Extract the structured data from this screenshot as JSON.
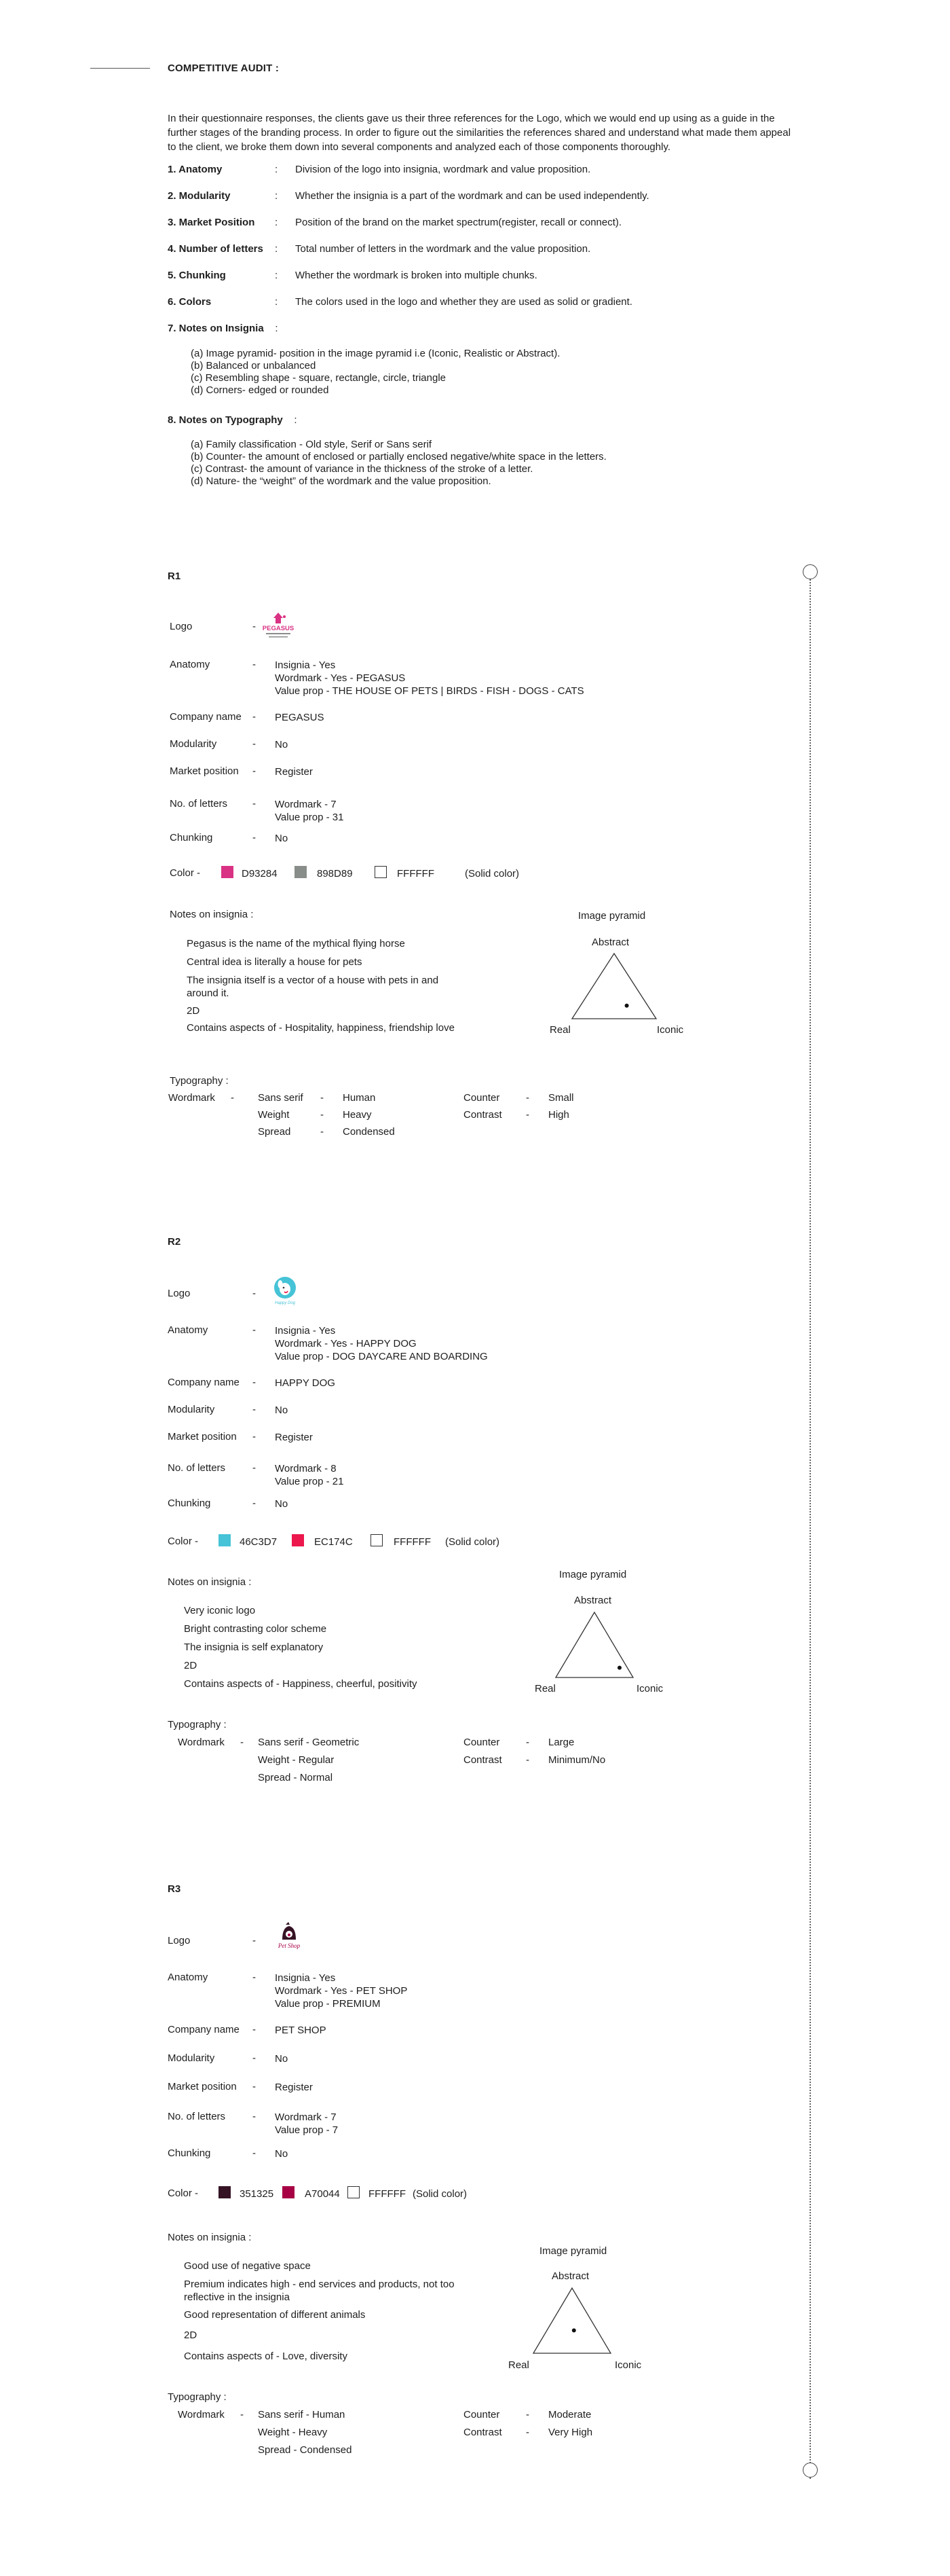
{
  "header": {
    "title": "COMPETITIVE AUDIT :"
  },
  "intro": "In their questionnaire responses, the clients gave us their three references for the Logo, which we would end up using as a guide in the further stages of the branding process. In order to figure out the similarities the references shared and understand what made them appeal to the client, we broke them down into several components and analyzed each of those components thoroughly.",
  "criteria": [
    {
      "key": "1. Anatomy",
      "desc": "Division of the logo into insignia, wordmark and value proposition."
    },
    {
      "key": "2. Modularity",
      "desc": "Whether the insignia is a part of the wordmark and can be used independently."
    },
    {
      "key": "3. Market Position",
      "desc": "Position of the brand on the market spectrum(register, recall or connect)."
    },
    {
      "key": "4. Number of letters",
      "desc": "Total number of letters in the wordmark and the value proposition."
    },
    {
      "key": "5. Chunking",
      "desc": "Whether the wordmark is broken into multiple chunks."
    },
    {
      "key": "6. Colors",
      "desc": "The colors used in the logo and whether they are used as solid or gradient."
    },
    {
      "key": "7. Notes on Insignia",
      "desc": ""
    },
    {
      "key": "8. Notes on Typography",
      "desc": ""
    }
  ],
  "insignia_notes": [
    "(a) Image pyramid- position in the image pyramid i.e (Iconic, Realistic or Abstract).",
    "(b) Balanced or unbalanced",
    "(c) Resembling shape - square, rectangle, circle, triangle",
    "(d) Corners- edged or rounded"
  ],
  "typography_notes": [
    "(a) Family classification - Old style, Serif or Sans serif",
    "(b) Counter- the amount of enclosed or partially enclosed negative/white space in the letters.",
    "(c) Contrast- the amount of variance in the thickness of the stroke of a letter.",
    "(d) Nature- the “weight” of the wordmark and the value proposition."
  ],
  "labels": {
    "logo": "Logo",
    "anatomy": "Anatomy",
    "company": "Company name",
    "modularity": "Modularity",
    "market": "Market position",
    "letters": "No. of letters",
    "chunking": "Chunking",
    "color": "Color",
    "notes": "Notes on insignia :",
    "typography": "Typography :",
    "wordmark": "Wordmark",
    "counter": "Counter",
    "contrast": "Contrast",
    "dash": "-",
    "pyramid_title": "Image pyramid",
    "abstract": "Abstract",
    "real": "Real",
    "iconic": "Iconic"
  },
  "references": [
    {
      "id": "R1",
      "logo_icon": "pegasus-logo",
      "logo_text": "PEGASUS",
      "anatomy": [
        "Insignia - Yes",
        "Wordmark - Yes - PEGASUS",
        "Value prop - THE HOUSE OF PETS | BIRDS - FISH - DOGS - CATS"
      ],
      "company": "PEGASUS",
      "modularity": "No",
      "market": "Register",
      "letters": [
        "Wordmark -  7",
        "Value prop -  31"
      ],
      "chunking": "No",
      "colors": [
        {
          "hex": "#D93284",
          "label": "D93284"
        },
        {
          "hex": "#898D89",
          "label": "898D89"
        },
        {
          "hex": "#FFFFFF",
          "label": "FFFFFF"
        }
      ],
      "color_type": "(Solid color)",
      "notes": [
        "Pegasus is the name of the mythical flying horse",
        "Central idea is literally a house for pets",
        "The insignia itself is a vector of a house with pets in and around it.",
        "2D",
        "Contains aspects of - Hospitality, happiness, friendship love"
      ],
      "pyramid_point": {
        "real": 0.25,
        "iconic": 0.55,
        "abstract": 0.2
      },
      "typography": {
        "family_label": "Sans serif",
        "family": "Human",
        "weight_label": "Weight",
        "weight": "Heavy",
        "spread_label": "Spread",
        "spread": "Condensed",
        "counter": "Small",
        "contrast": "High"
      }
    },
    {
      "id": "R2",
      "logo_icon": "happy-dog-logo",
      "logo_text": "Happy Dog",
      "anatomy": [
        "Insignia - Yes",
        "Wordmark - Yes - HAPPY DOG",
        "Value prop - DOG DAYCARE AND BOARDING"
      ],
      "company": "HAPPY DOG",
      "modularity": "No",
      "market": "Register",
      "letters": [
        "Wordmark -  8",
        "Value prop -  21"
      ],
      "chunking": "No",
      "colors": [
        {
          "hex": "#46C3D7",
          "label": "46C3D7"
        },
        {
          "hex": "#EC174C",
          "label": "EC174C"
        },
        {
          "hex": "#FFFFFF",
          "label": "FFFFFF"
        }
      ],
      "color_type": "(Solid color)",
      "notes": [
        "Very iconic logo",
        "Bright contrasting color scheme",
        "The insignia is self explanatory",
        "2D",
        "Contains aspects of - Happiness, cheerful, positivity"
      ],
      "pyramid_point": {
        "real": 0.1,
        "iconic": 0.75,
        "abstract": 0.15
      },
      "typography": {
        "family": "Sans serif - Geometric",
        "weight": "Weight - Regular",
        "spread": "Spread - Normal",
        "counter": "Large",
        "contrast": "Minimum/No"
      }
    },
    {
      "id": "R3",
      "logo_icon": "pet-shop-logo",
      "logo_text": "Pet Shop",
      "anatomy": [
        "Insignia - Yes",
        "Wordmark - Yes - PET SHOP",
        "Value prop - PREMIUM"
      ],
      "company": "PET SHOP",
      "modularity": "No",
      "market": "Register",
      "letters": [
        "Wordmark -  7",
        "Value prop -  7"
      ],
      "chunking": "No",
      "colors": [
        {
          "hex": "#351325",
          "label": "351325"
        },
        {
          "hex": "#A70044",
          "label": "A70044"
        },
        {
          "hex": "#FFFFFF",
          "label": "FFFFFF"
        }
      ],
      "color_type": "(Solid color)",
      "notes": [
        "Good use of negative space",
        "Premium indicates high - end services and products, not too reflective in the insignia",
        "Good representation of different animals",
        "2D",
        "Contains aspects of - Love, diversity"
      ],
      "pyramid_point": {
        "real": 0.3,
        "iconic": 0.35,
        "abstract": 0.35
      },
      "typography": {
        "family": "Sans serif - Human",
        "weight": "Weight - Heavy",
        "spread": "Spread - Condensed",
        "counter": "Moderate",
        "contrast": "Very High"
      }
    }
  ]
}
